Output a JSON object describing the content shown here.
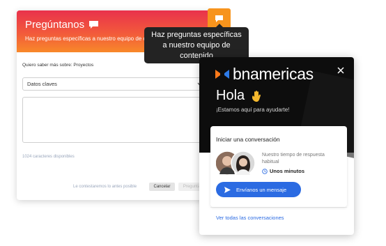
{
  "form": {
    "title": "Pregúntanos",
    "subtitle": "Haz preguntas específicas a nuestro equipo de c",
    "topic_label": "Quiero saber más sobre: Proyectos",
    "select_value": "Datos claves",
    "chars_available": "1024 caracteres disponibles",
    "footer_note": "Le contestaremos lo antes posible",
    "cancel_label": "Cancelar",
    "ask_label": "Preguntar"
  },
  "tooltip": {
    "line1": "Haz preguntas específicas",
    "line2": "a nuestro equipo de",
    "line3": "contenido"
  },
  "chat": {
    "brand": "bnamericas",
    "greeting": "Hola",
    "help": "¡Estamos aquí para ayudarte!",
    "start_title": "Iniciar una conversación",
    "response_text": "Nuestro tiempo de respuesta habitual",
    "response_time": "Unos minutos",
    "send_label": "Envíanos un mensaje",
    "see_all": "Ver todas las conversaciones"
  },
  "colors": {
    "header_top": "#e9324c",
    "header_bottom": "#f8892a",
    "orange_button": "#f7941d",
    "chat_header": "#0d0d0d",
    "primary_blue": "#2b6be2"
  },
  "icons": [
    "chat-bubble-icon",
    "chevron-down-icon",
    "resize-grip-icon",
    "close-icon",
    "waving-hand-icon",
    "clock-icon",
    "send-icon",
    "bnamericas-logo-icon"
  ]
}
